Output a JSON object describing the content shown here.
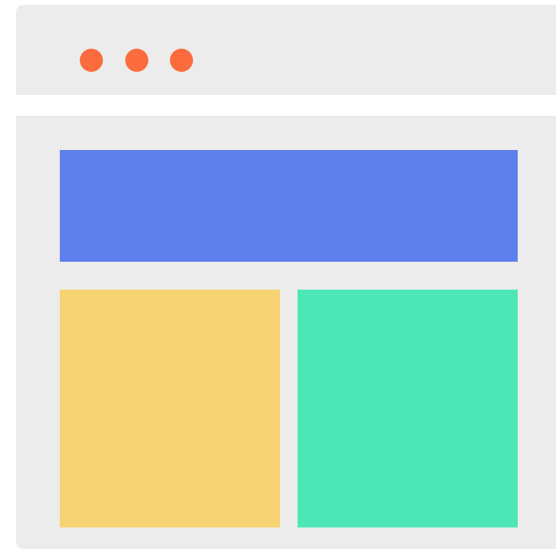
{
  "colors": {
    "window_bg": "#ececec",
    "window_control": "#fa6c3d",
    "header_block": "#5e80ec",
    "left_block": "#f7d272",
    "right_block": "#4de6b7"
  },
  "window_controls": [
    "close-control",
    "minimize-control",
    "maximize-control"
  ]
}
